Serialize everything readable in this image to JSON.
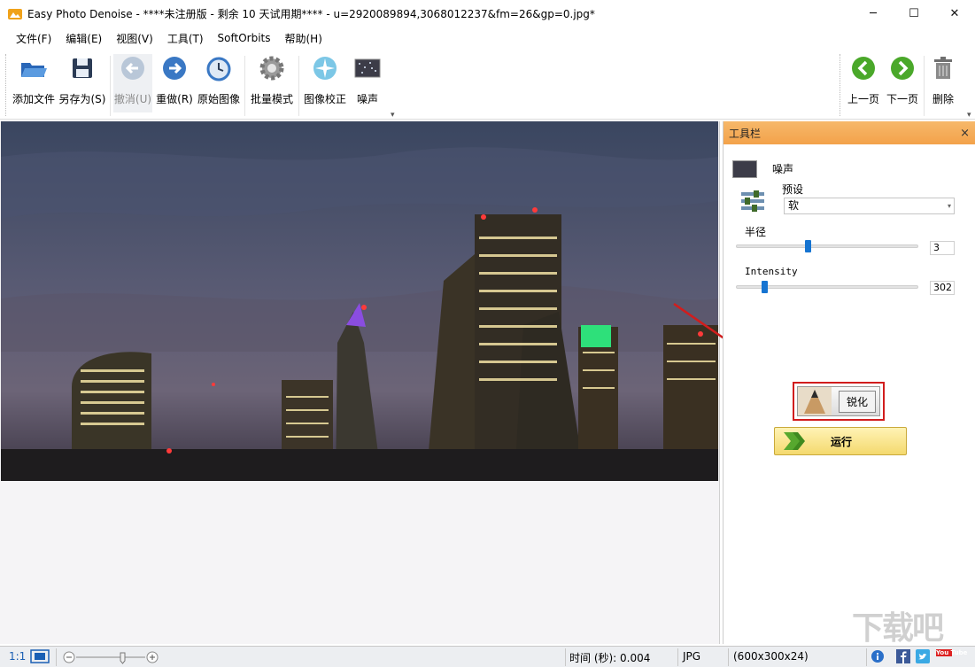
{
  "titlebar": {
    "title": "Easy Photo Denoise - ****未注册版 - 剩余 10 天试用期**** - u=2920089894,3068012237&fm=26&gp=0.jpg*",
    "minimize": "─",
    "maximize": "☐",
    "close": "✕"
  },
  "menu": {
    "items": [
      "文件(F)",
      "编辑(E)",
      "视图(V)",
      "工具(T)",
      "SoftOrbits",
      "帮助(H)"
    ]
  },
  "toolbar": {
    "add_file": "添加文件",
    "save_as": "另存为(S)",
    "undo": "撤消(U)",
    "redo": "重做(R)",
    "original": "原始图像",
    "batch": "批量模式",
    "correct": "图像校正",
    "noise": "噪声",
    "prev": "上一页",
    "next": "下一页",
    "delete": "删除",
    "more": "▾"
  },
  "panel": {
    "title": "工具栏",
    "close": "×",
    "noise_label": "噪声",
    "preset_label": "预设",
    "preset_value": "软",
    "radius_label": "半径",
    "radius_value": "3",
    "radius_fraction": 0.39,
    "intensity_label": "Intensity",
    "intensity_value": "302",
    "intensity_fraction": 0.14,
    "sharpen_label": "锐化",
    "run_label": "运行"
  },
  "status": {
    "ratio": "1:1",
    "time": "时间 (秒): 0.004",
    "format": "JPG",
    "dimensions": "(600x300x24)",
    "youtube": "You Tube"
  },
  "watermark": "下载吧",
  "colors": {
    "panel_header": "#f3a24a",
    "highlight_red": "#d11d1d",
    "run_button": "#f4d96e",
    "accent_blue": "#1674d1"
  }
}
